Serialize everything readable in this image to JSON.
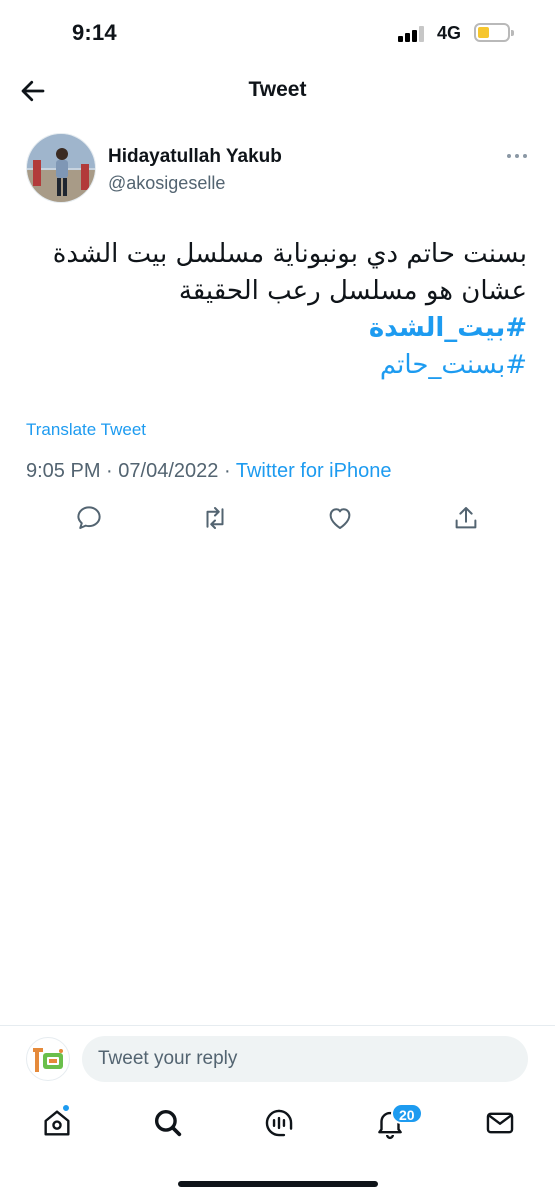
{
  "status_bar": {
    "time": "9:14",
    "network": "4G",
    "battery_fraction": 0.4,
    "icons": [
      "signal-icon",
      "battery-icon"
    ]
  },
  "header": {
    "title": "Tweet",
    "back_icon": "arrow-left-icon"
  },
  "tweet": {
    "author_name": "Hidayatullah Yakub",
    "author_handle": "@akosigeselle",
    "text_lines": [
      "بسنت حاتم دي بونبوناية مسلسل بيت الشدة",
      "عشان هو مسلسل رعب الحقيقة"
    ],
    "hashtags": [
      "#بيت_الشدة",
      "#بسنت_حاتم"
    ],
    "translate_label": "Translate Tweet",
    "time": "9:05 PM",
    "separator": "·",
    "date": "07/04/2022",
    "source": "Twitter for iPhone",
    "actions": [
      "reply-icon",
      "retweet-icon",
      "like-icon",
      "share-icon"
    ]
  },
  "reply": {
    "placeholder": "Tweet your reply"
  },
  "bottom_nav": {
    "items": [
      "home-icon",
      "search-icon",
      "spaces-icon",
      "notifications-icon",
      "messages-icon"
    ],
    "notification_count": "20"
  },
  "colors": {
    "accent": "#1d9bf0",
    "text": "#0f1419",
    "secondary": "#536471",
    "battery": "#f6c62e"
  }
}
